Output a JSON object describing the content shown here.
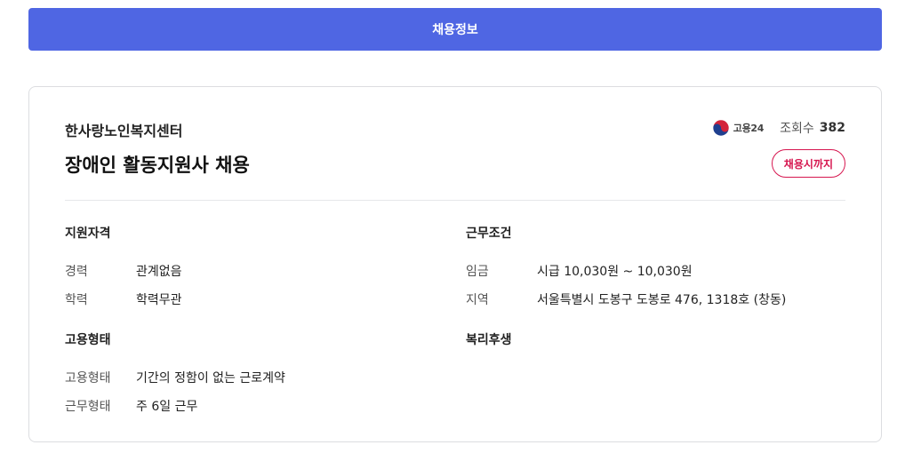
{
  "header": {
    "tab_label": "채용정보"
  },
  "job": {
    "company": "한사랑노인복지센터",
    "title": "장애인 활동지원사 채용",
    "source_name": "고용24",
    "views_label": "조회수",
    "views_count": "382",
    "deadline_label": "채용시까지"
  },
  "sections": {
    "qualification": {
      "title": "지원자격",
      "rows": [
        {
          "label": "경력",
          "value": "관계없음"
        },
        {
          "label": "학력",
          "value": "학력무관"
        }
      ]
    },
    "conditions": {
      "title": "근무조건",
      "rows": [
        {
          "label": "임금",
          "value": "시급 10,030원 ~ 10,030원"
        },
        {
          "label": "지역",
          "value": "서울특별시 도봉구 도봉로 476, 1318호 (창동)"
        }
      ]
    },
    "employment": {
      "title": "고용형태",
      "rows": [
        {
          "label": "고용형태",
          "value": "기간의 정함이 없는 근로계약"
        },
        {
          "label": "근무형태",
          "value": "주 6일 근무"
        }
      ]
    },
    "welfare": {
      "title": "복리후생"
    }
  },
  "colors": {
    "accent": "#4f66e3",
    "deadline": "#d6164f"
  },
  "icons": {
    "source_logo": "korea-taegeuk-icon"
  }
}
